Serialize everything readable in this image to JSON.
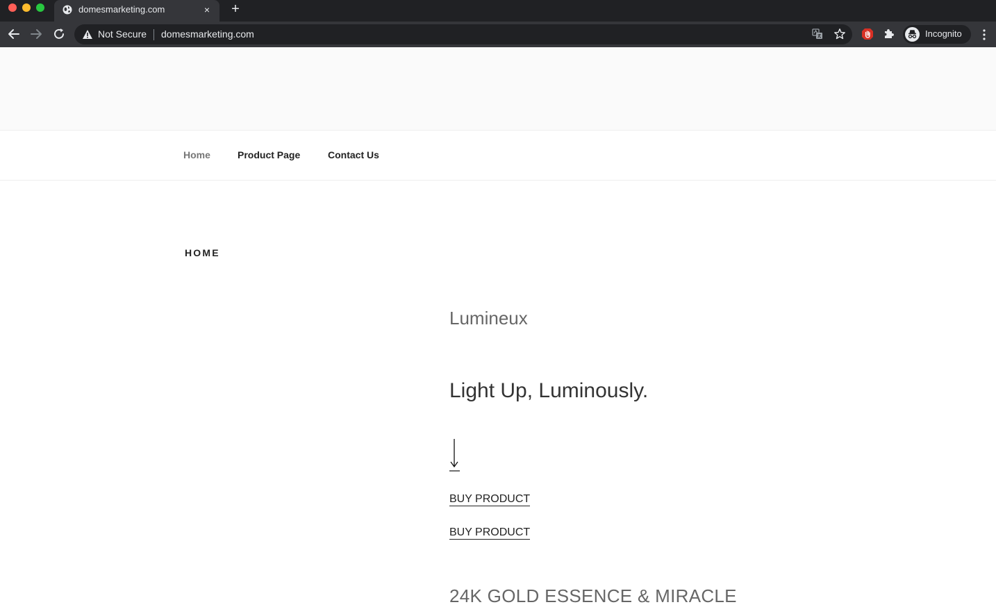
{
  "browser": {
    "tab": {
      "title": "domesmarketing.com",
      "close_glyph": "×"
    },
    "new_tab_glyph": "+",
    "omnibox": {
      "security_label": "Not Secure",
      "url": "domesmarketing.com"
    },
    "profile_label": "Incognito",
    "icons": [
      "globe-icon",
      "back-arrow-icon",
      "forward-arrow-icon",
      "reload-icon",
      "warning-icon",
      "translate-icon",
      "star-icon",
      "adblock-icon",
      "puzzle-icon",
      "incognito-icon",
      "kebab-menu-icon"
    ]
  },
  "site": {
    "nav": {
      "items": [
        {
          "label": "Home",
          "current": true
        },
        {
          "label": "Product Page",
          "current": false
        },
        {
          "label": "Contact Us",
          "current": false
        }
      ]
    },
    "page_title": "HOME",
    "brand_name": "Lumineux",
    "tagline": "Light Up, Luminously.",
    "buy_links": [
      "BUY PRODUCT",
      "BUY PRODUCT"
    ],
    "product_heading": "24K GOLD ESSENCE & MIRACLE"
  },
  "colors": {
    "chrome_dark": "#202124",
    "chrome_toolbar": "#35363a",
    "chrome_text": "#e8eaed",
    "header_band": "#fafafa",
    "nav_current": "#767676",
    "text_dark": "#222222"
  }
}
